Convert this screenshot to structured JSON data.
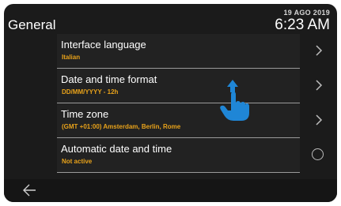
{
  "header": {
    "title": "General",
    "date": "19 AGO 2019",
    "time": "6:23 AM"
  },
  "settings": [
    {
      "label": "Interface language",
      "value": "Italian",
      "control": "chevron-right-icon"
    },
    {
      "label": "Date and time format",
      "value": "DD/MM/YYYY - 12h",
      "control": "chevron-right-icon"
    },
    {
      "label": "Time zone",
      "value": "(GMT +01:00) Amsterdam, Berlin, Rome",
      "control": "chevron-right-icon"
    },
    {
      "label": "Automatic date and time",
      "value": "Not active",
      "control": "radio-off"
    }
  ],
  "footer": {
    "back_icon": "back-arrow-icon"
  },
  "overlay": {
    "icon": "swipe-up-hand-icon"
  },
  "colors": {
    "background": "#1b1b1b",
    "accent": "#e8a21a",
    "text": "#ffffff",
    "hand": "#1f86d6"
  }
}
